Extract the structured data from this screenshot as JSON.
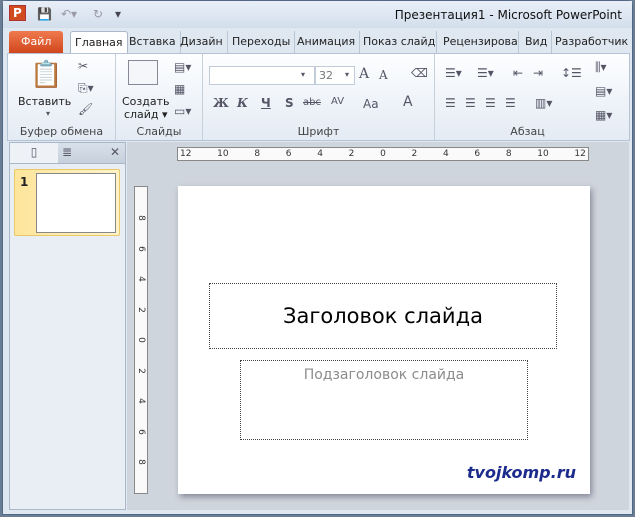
{
  "window": {
    "title": "Презентация1  -  Microsoft PowerPoint",
    "app_icon": "P"
  },
  "tabs": [
    "Файл",
    "Главная",
    "Вставка",
    "Дизайн",
    "Переходы",
    "Анимация",
    "Показ слайдо",
    "Рецензирова",
    "Вид",
    "Разработчик"
  ],
  "ribbon": {
    "clipboard": {
      "paste": "Вставить",
      "label": "Буфер обмена"
    },
    "slides": {
      "new_slide_1": "Создать",
      "new_slide_2": "слайд",
      "label": "Слайды"
    },
    "font": {
      "font_name": "",
      "font_size": "32",
      "bold": "Ж",
      "italic": "К",
      "underline": "Ч",
      "shadow": "S",
      "strike": "abc",
      "spacing": "AV",
      "case": "Aa",
      "color": "A",
      "grow": "A",
      "shrink": "A",
      "label": "Шрифт"
    },
    "paragraph": {
      "label": "Абзац"
    }
  },
  "panel": {
    "slide_number": "1"
  },
  "ruler": {
    "horizontal": [
      "12",
      "10",
      "8",
      "6",
      "4",
      "2",
      "0",
      "2",
      "4",
      "6",
      "8",
      "10",
      "12"
    ],
    "vertical": [
      "8",
      "6",
      "4",
      "2",
      "0",
      "2",
      "4",
      "6",
      "8"
    ]
  },
  "slide": {
    "title_placeholder": "Заголовок слайда",
    "subtitle_placeholder": "Подзаголовок слайда"
  },
  "watermark": "tvojkomp.ru"
}
